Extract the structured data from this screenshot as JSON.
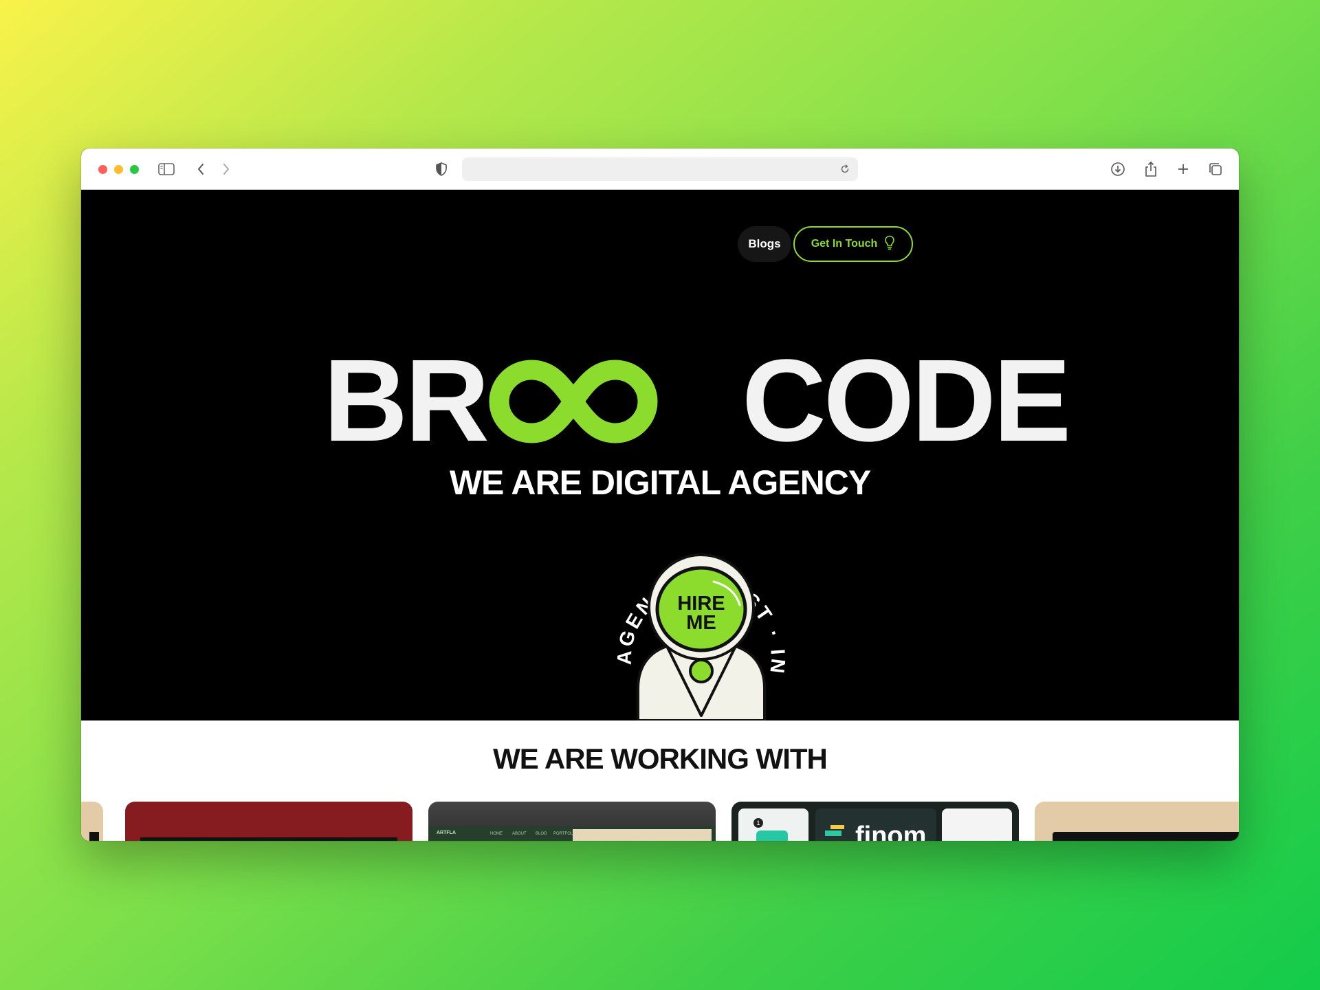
{
  "nav": {
    "blogs_label": "Blogs",
    "cta_label": "Get In Touch",
    "cta_icon": "lightbulb-icon"
  },
  "hero": {
    "brand_left": "BR",
    "brand_infinity_icon": "infinity-icon",
    "brand_right": "CODE",
    "tagline": "WE ARE DIGITAL AGENCY",
    "badge_ring_text": "AGENCY · BEST · IN",
    "badge_helmet_text": "HIRE ME"
  },
  "partners": {
    "title": "WE ARE WORKING WITH",
    "card_texts": [
      "ARTFLA",
      "HOME",
      "ABOUT",
      "BLOG",
      "PORTFOLIO",
      "finom"
    ]
  },
  "colors": {
    "accent_green": "#8cdc2e",
    "hero_background": "#000000",
    "section_background": "#ffffff"
  }
}
